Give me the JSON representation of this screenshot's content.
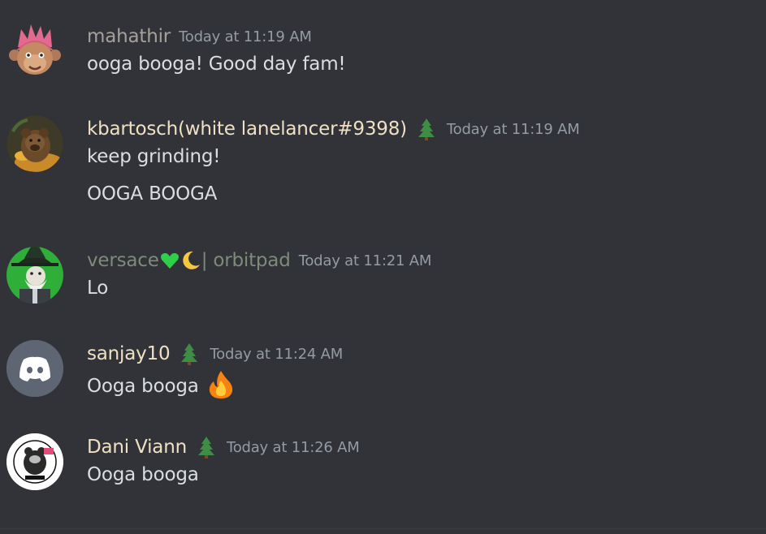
{
  "messages": [
    {
      "username": "mahathir",
      "username_color": "#a6a09a",
      "badge": "",
      "timestamp": "Today at 11:19 AM",
      "lines": [
        "ooga booga! Good day fam!"
      ],
      "avatar_icon": "pink-haired-character-avatar"
    },
    {
      "username": "kbartosch(white lanelancer#9398)",
      "username_color": "#f0e0c3",
      "badge": "tree-emoji",
      "timestamp": "Today at 11:19 AM",
      "lines": [
        "keep grinding!",
        "OOGA BOOGA"
      ],
      "avatar_icon": "bear-avatar"
    },
    {
      "username_parts": [
        "versace",
        "green-heart-emoji",
        "crescent-moon-emoji",
        "| orbitpad"
      ],
      "username_prefix": "versace",
      "username_suffix": "| orbitpad",
      "username_color": "#7e8a7a",
      "badge": "",
      "timestamp": "Today at 11:21 AM",
      "lines": [
        "Lo"
      ],
      "avatar_icon": "wizard-avatar"
    },
    {
      "username": "sanjay10",
      "username_color": "#f0e0c3",
      "badge": "tree-emoji",
      "timestamp": "Today at 11:24 AM",
      "lines": [
        "Ooga booga"
      ],
      "line_emoji": "fire-emoji",
      "avatar_icon": "discord-default-avatar"
    },
    {
      "username": "Dani Viann",
      "username_color": "#f0e0c3",
      "badge": "tree-emoji",
      "timestamp": "Today at 11:26 AM",
      "lines": [
        "Ooga booga"
      ],
      "avatar_icon": "cartoon-badge-avatar"
    }
  ],
  "colors": {
    "background": "#313338",
    "text": "#dbdee1",
    "timestamp": "#949ba4",
    "discord_avatar_bg": "#5f6673"
  }
}
